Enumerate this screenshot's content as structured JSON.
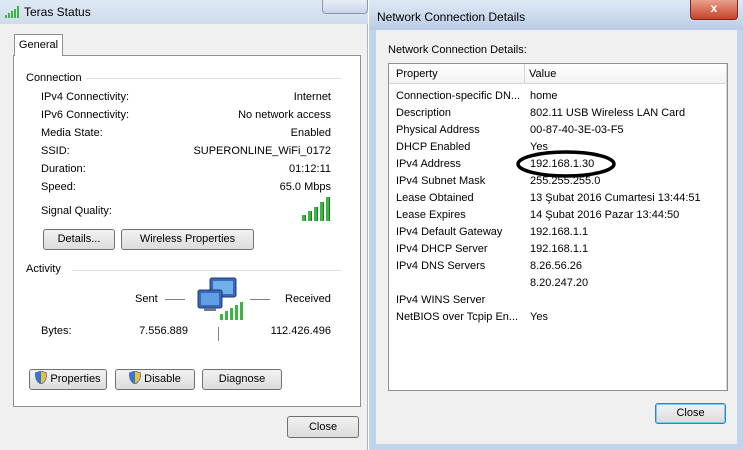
{
  "status_window": {
    "title": "Teras Status",
    "tab_general": "General",
    "connection": {
      "section_label": "Connection",
      "rows": [
        {
          "label": "IPv4 Connectivity:",
          "value": "Internet"
        },
        {
          "label": "IPv6 Connectivity:",
          "value": "No network access"
        },
        {
          "label": "Media State:",
          "value": "Enabled"
        },
        {
          "label": "SSID:",
          "value": "SUPERONLINE_WiFi_0172"
        },
        {
          "label": "Duration:",
          "value": "01:12:11"
        },
        {
          "label": "Speed:",
          "value": "65.0 Mbps"
        }
      ],
      "signal_label": "Signal Quality:",
      "signal_level": "5/5",
      "details_button": "Details...",
      "wireless_properties_button": "Wireless Properties"
    },
    "activity": {
      "section_label": "Activity",
      "sent_label": "Sent",
      "received_label": "Received",
      "bytes_label": "Bytes:",
      "bytes_sent": "7.556.889",
      "bytes_received": "112.426.496"
    },
    "properties_button": "Properties",
    "disable_button": "Disable",
    "diagnose_button": "Diagnose",
    "close_button": "Close"
  },
  "details_window": {
    "title": "Network Connection Details",
    "caption": "Network Connection Details:",
    "col_property": "Property",
    "col_value": "Value",
    "rows": [
      {
        "property": "Connection-specific DN...",
        "value": "home"
      },
      {
        "property": "Description",
        "value": "802.11 USB Wireless LAN Card"
      },
      {
        "property": "Physical Address",
        "value": "00-87-40-3E-03-F5"
      },
      {
        "property": "DHCP Enabled",
        "value": "Yes"
      },
      {
        "property": "IPv4 Address",
        "value": "192.168.1.30"
      },
      {
        "property": "IPv4 Subnet Mask",
        "value": "255.255.255.0"
      },
      {
        "property": "Lease Obtained",
        "value": "13 Şubat 2016 Cumartesi 13:44:51"
      },
      {
        "property": "Lease Expires",
        "value": "14 Şubat 2016 Pazar 13:44:50"
      },
      {
        "property": "IPv4 Default Gateway",
        "value": "192.168.1.1"
      },
      {
        "property": "IPv4 DHCP Server",
        "value": "192.168.1.1"
      },
      {
        "property": "IPv4 DNS Servers",
        "value": "8.26.56.26"
      },
      {
        "property": "",
        "value": "8.20.247.20"
      },
      {
        "property": "IPv4 WINS Server",
        "value": ""
      },
      {
        "property": "NetBIOS over Tcpip En...",
        "value": "Yes"
      }
    ],
    "close_button": "Close",
    "close_glyph": "x"
  },
  "colors": {
    "signal_green": "#3db545",
    "annotation_ellipse": "#000000",
    "close_red": "#c7442c"
  }
}
